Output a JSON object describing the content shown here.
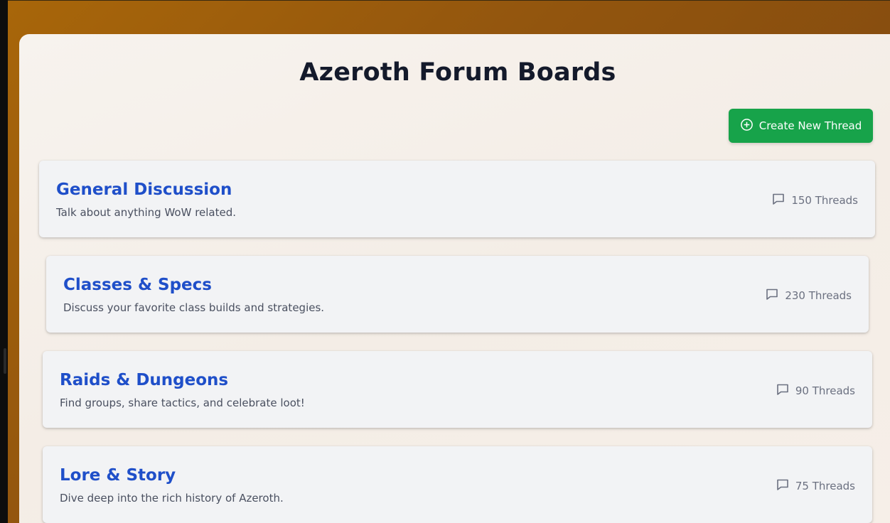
{
  "page": {
    "title": "Azeroth Forum Boards"
  },
  "toolbar": {
    "create_label": "Create New Thread",
    "create_icon": "plus-circle-icon",
    "accent_color": "#17a34a"
  },
  "boards": [
    {
      "title": "General Discussion",
      "description": "Talk about anything WoW related.",
      "threads": "150 Threads"
    },
    {
      "title": "Classes & Specs",
      "description": "Discuss your favorite class builds and strategies.",
      "threads": "230 Threads"
    },
    {
      "title": "Raids & Dungeons",
      "description": "Find groups, share tactics, and celebrate loot!",
      "threads": "90 Threads"
    },
    {
      "title": "Lore & Story",
      "description": "Dive deep into the rich history of Azeroth.",
      "threads": "75 Threads"
    }
  ],
  "colors": {
    "title_text": "#141a2b",
    "board_title": "#1f4fc9",
    "card_bg": "#f2f3f5"
  }
}
